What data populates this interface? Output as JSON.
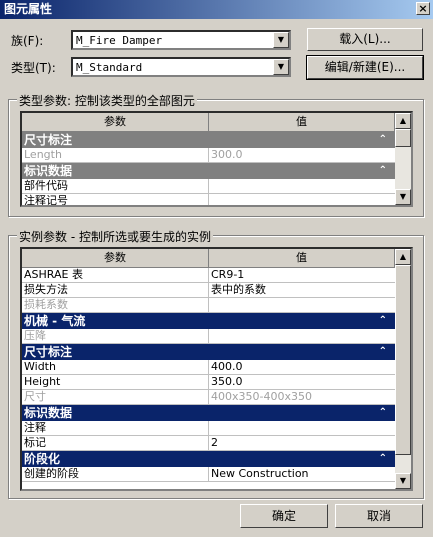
{
  "window": {
    "title": "图元属性",
    "close_glyph": "×"
  },
  "family": {
    "label": "族(F):",
    "value": "M_Fire Damper"
  },
  "type": {
    "label": "类型(T):",
    "value": "M_Standard"
  },
  "buttons": {
    "load": "载入(L)...",
    "edit_new": "编辑/新建(E)...",
    "ok": "确定",
    "cancel": "取消"
  },
  "type_params": {
    "legend": "类型参数: 控制该类型的全部图元",
    "headers": [
      "参数",
      "值"
    ],
    "rows": [
      {
        "kind": "cat",
        "label": "尺寸标注"
      },
      {
        "kind": "row",
        "param": "Length",
        "value": "300.0",
        "disabled": true
      },
      {
        "kind": "cat",
        "label": "标识数据"
      },
      {
        "kind": "row",
        "param": "部件代码",
        "value": ""
      },
      {
        "kind": "row",
        "param": "注释记号",
        "value": ""
      }
    ]
  },
  "instance_params": {
    "legend": "实例参数 - 控制所选或要生成的实例",
    "headers": [
      "参数",
      "值"
    ],
    "rows": [
      {
        "kind": "row",
        "param": "ASHRAE 表",
        "value": "CR9-1"
      },
      {
        "kind": "row",
        "param": "损失方法",
        "value": "表中的系数"
      },
      {
        "kind": "row",
        "param": "损耗系数",
        "value": "",
        "disabled": true
      },
      {
        "kind": "cat",
        "label": "机械 - 气流"
      },
      {
        "kind": "row",
        "param": "压降",
        "value": "",
        "disabled": true
      },
      {
        "kind": "cat",
        "label": "尺寸标注"
      },
      {
        "kind": "row",
        "param": "Width",
        "value": "400.0"
      },
      {
        "kind": "row",
        "param": "Height",
        "value": "350.0"
      },
      {
        "kind": "row",
        "param": "尺寸",
        "value": "400x350-400x350",
        "disabled": true
      },
      {
        "kind": "cat",
        "label": "标识数据"
      },
      {
        "kind": "row",
        "param": "注释",
        "value": ""
      },
      {
        "kind": "row",
        "param": "标记",
        "value": "2"
      },
      {
        "kind": "cat",
        "label": "阶段化"
      },
      {
        "kind": "row",
        "param": "创建的阶段",
        "value": "New Construction"
      }
    ]
  },
  "icons": {
    "collapse": "chevron-up-double-icon",
    "dropdown": "chevron-down-icon"
  }
}
